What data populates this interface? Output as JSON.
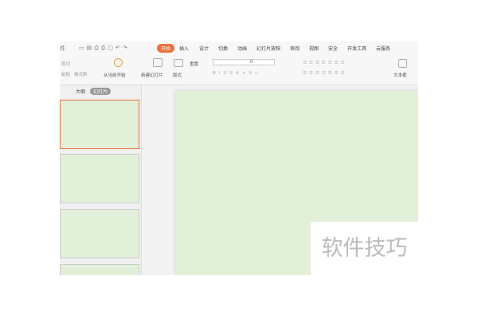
{
  "toolbar": {
    "file_fragment": "件",
    "tabs": [
      "开始",
      "插入",
      "设计",
      "切换",
      "动画",
      "幻灯片放映",
      "审阅",
      "视图",
      "安全",
      "开发工具",
      "云服务"
    ],
    "active_tab": "开始"
  },
  "ribbon": {
    "cut": "剪切",
    "paste": "粘贴",
    "format_painter": "格式刷",
    "play_from_current": "从当前开始",
    "new_slide": "新建幻灯片",
    "layout": "版式",
    "reset": "重置",
    "font_size": "0",
    "text_box": "文本框"
  },
  "panel": {
    "outline_tab": "大纲",
    "slides_tab": "幻灯片"
  },
  "watermark": "软件技巧"
}
